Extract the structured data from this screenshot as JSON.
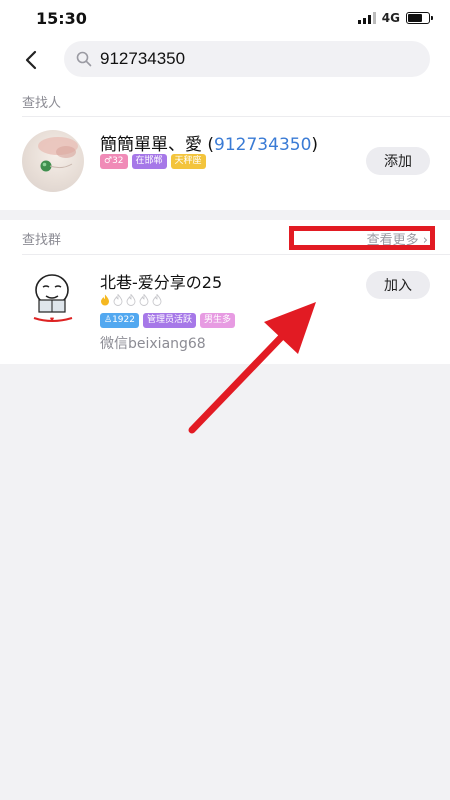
{
  "status_bar": {
    "time": "15:30",
    "network": "4G"
  },
  "search": {
    "query": "912734350"
  },
  "people": {
    "section_title": "查找人",
    "result": {
      "name": "簡簡單單、愛",
      "qq_number": "912734350",
      "tags": [
        {
          "text": "♂32",
          "color": "#f08bb7"
        },
        {
          "text": "在邯郸",
          "color": "#a678e8"
        },
        {
          "text": "天秤座",
          "color": "#f3c43c"
        }
      ],
      "action_label": "添加"
    }
  },
  "groups": {
    "section_title": "查找群",
    "see_more": "查看更多",
    "result": {
      "name": "北巷-爱分享の25",
      "level": {
        "filled": 1,
        "total": 5
      },
      "tags": [
        {
          "text": "♙1922",
          "color": "#52a8f0"
        },
        {
          "text": "管理员活跃",
          "color": "#a678e8"
        },
        {
          "text": "男生多",
          "color": "#e79be2"
        }
      ],
      "description": "微信beixiang68",
      "action_label": "加入"
    }
  },
  "colors": {
    "accent": "#3a7bd5",
    "annotation_red": "#e21b23"
  }
}
